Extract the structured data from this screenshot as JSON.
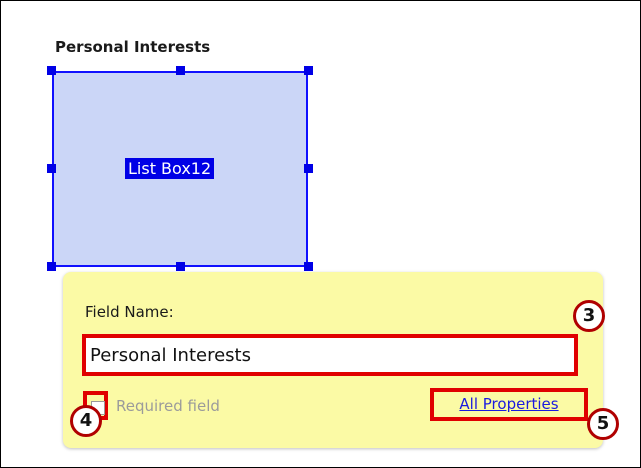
{
  "section": {
    "label": "Personal Interests"
  },
  "listbox": {
    "label": "List Box12"
  },
  "popup": {
    "field_name_label": "Field Name:",
    "field_name_value": "Personal Interests",
    "required_label": "Required field",
    "all_properties_link": "All Properties"
  },
  "callouts": [
    "3",
    "4",
    "5"
  ],
  "colors": {
    "popup_background": "#fbfaa5",
    "listbox_fill": "#cbd6f7",
    "selection_blue": "#0000e6",
    "highlight_red": "#e00000"
  }
}
